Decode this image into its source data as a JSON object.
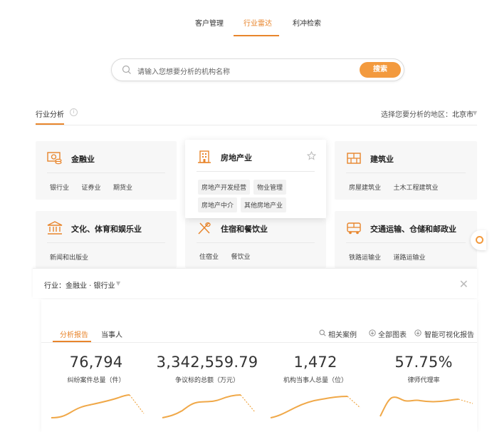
{
  "nav": {
    "tabs": [
      {
        "label": "客户管理",
        "active": false
      },
      {
        "label": "行业雷达",
        "active": true
      },
      {
        "label": "利冲检索",
        "active": false
      }
    ]
  },
  "search": {
    "placeholder": "请输入您想要分析的机构名称",
    "button_label": "搜索",
    "icon": "search-icon"
  },
  "industry": {
    "title": "行业分析",
    "info_icon": "info-icon",
    "region_label": "选择您要分析的地区：",
    "region_value": "北京市"
  },
  "cards": [
    {
      "title": "金融业",
      "icon": "finance-icon",
      "subs": [
        "银行业",
        "证券业",
        "期货业"
      ]
    },
    {
      "title": "房地产业",
      "icon": "building-icon",
      "subs": [
        "房地产开发经营",
        "物业管理",
        "房地产中介",
        "其他房地产业"
      ],
      "starred": false
    },
    {
      "title": "建筑业",
      "icon": "bricks-icon",
      "subs": [
        "房屋建筑业",
        "土木工程建筑业"
      ]
    },
    {
      "title": "文化、体育和娱乐业",
      "icon": "museum-icon",
      "subs": [
        "新闻和出版业"
      ]
    },
    {
      "title": "住宿和餐饮业",
      "icon": "dining-icon",
      "subs": [
        "住宿业",
        "餐饮业"
      ]
    },
    {
      "title": "交通运输、仓储和邮政业",
      "icon": "bus-icon",
      "subs": [
        "铁路运输业",
        "道路运输业"
      ]
    }
  ],
  "filter": {
    "label": "行业：",
    "value": "金融业 · 银行业"
  },
  "report": {
    "tabs": [
      {
        "label": "分析报告",
        "active": true
      },
      {
        "label": "当事人",
        "active": false
      }
    ],
    "actions": [
      {
        "label": "相关案例",
        "icon": "search-icon"
      },
      {
        "label": "全部图表",
        "icon": "download-icon"
      },
      {
        "label": "智能可视化报告",
        "icon": "download-icon"
      }
    ],
    "kpis": [
      {
        "value": "76,794",
        "label": "纠纷案件总量（件）"
      },
      {
        "value": "3,342,559.79",
        "label": "争议标的总额（万元）"
      },
      {
        "value": "1,472",
        "label": "机构当事人总量（位）"
      },
      {
        "value": "57.75%",
        "label": "律师代理率"
      }
    ]
  },
  "colors": {
    "accent": "#e8852c",
    "button": "#f39a3e",
    "spark_line": "#f0a848"
  }
}
